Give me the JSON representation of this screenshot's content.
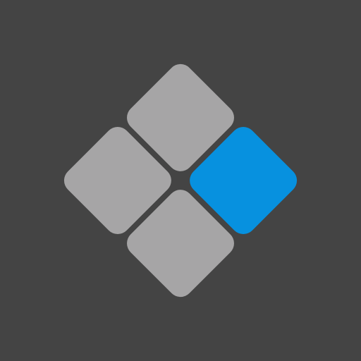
{
  "logo": {
    "icon_name": "diamond-four-squares-logo",
    "colors": {
      "background": "#444444",
      "tile_gray": "#a6a5a6",
      "tile_accent": "#0791df"
    },
    "tiles": [
      {
        "id": "top",
        "color_key": "tile_gray"
      },
      {
        "id": "left",
        "color_key": "tile_gray"
      },
      {
        "id": "right",
        "color_key": "tile_accent"
      },
      {
        "id": "bottom",
        "color_key": "tile_gray"
      }
    ]
  }
}
